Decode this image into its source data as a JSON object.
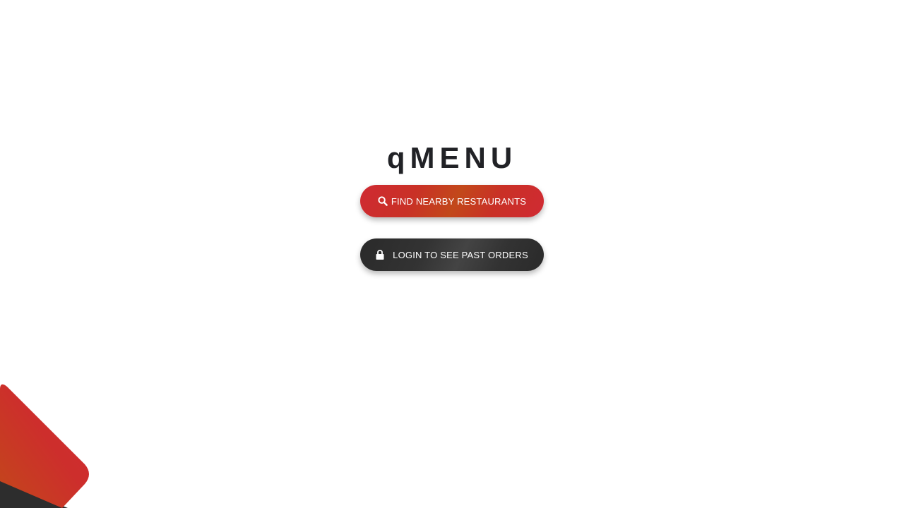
{
  "app": {
    "title": "qMENU"
  },
  "actions": {
    "find_label": "FIND NEARBY RESTAURANTS",
    "find_icon": "search-icon",
    "login_label": "LOGIN TO SEE PAST ORDERS",
    "login_icon": "lock-icon"
  },
  "colors": {
    "brand_red": "#cf2a32",
    "brand_orange": "#c2481a",
    "dark": "#2f2f2f",
    "title": "#212226",
    "background": "#ffffff"
  }
}
